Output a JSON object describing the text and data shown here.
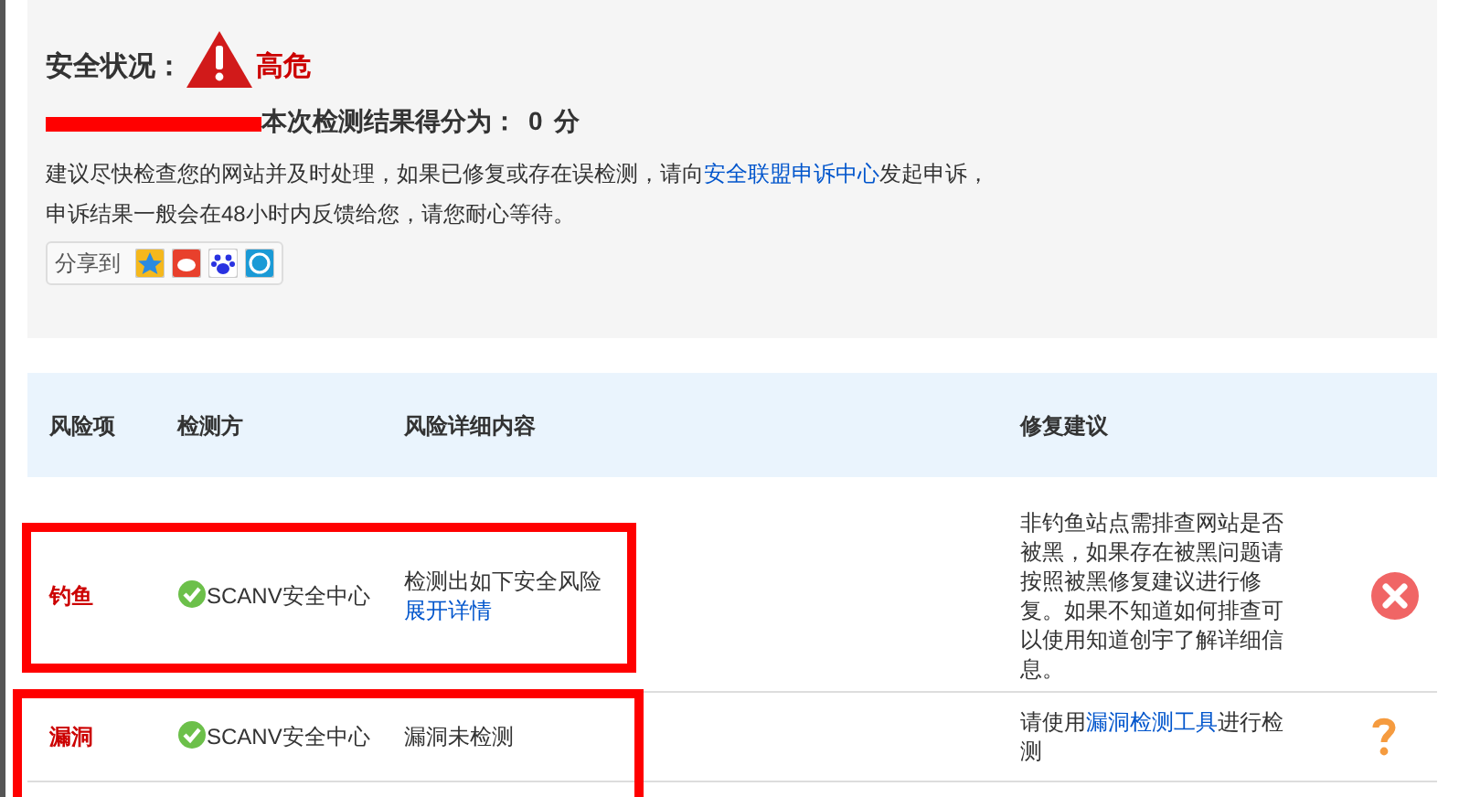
{
  "status": {
    "label": "安全状况：",
    "level": "高危",
    "score_label": "本次检测结果得分为：",
    "score": "0",
    "unit": "分"
  },
  "notice": {
    "line1_before": "建议尽快检查您的网站并及时处理，如果已修复或存在误检测，请向",
    "line1_link": "安全联盟申诉中心",
    "line1_after": "发起申诉，",
    "line2": "申诉结果一般会在48小时内反馈给您，请您耐心等待。"
  },
  "share": {
    "label": "分享到"
  },
  "table": {
    "columns": [
      "风险项",
      "检测方",
      "风险详细内容",
      "修复建议"
    ],
    "rows": [
      {
        "risk": "钓鱼",
        "detector": "SCANV安全中心",
        "detail": "检测出如下安全风险",
        "detail_link": "展开详情",
        "advice_before": "非钓鱼站点需排查网站是否被黑，如果存在被黑问题请按照被黑修复建议进行修复。如果不知道如何排查可以使用知道创宇了解详细信息。",
        "kind": "danger"
      },
      {
        "risk": "漏洞",
        "detector": "SCANV安全中心",
        "detail": "漏洞未检测",
        "advice_before": "请使用",
        "advice_link": "漏洞检测工具",
        "advice_after": "进行检测",
        "kind": "unknown"
      }
    ]
  }
}
